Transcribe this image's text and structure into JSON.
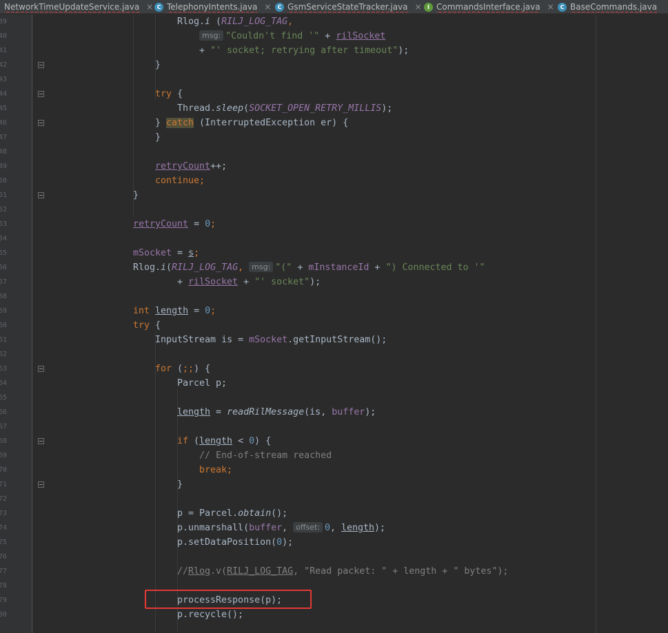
{
  "tabs": [
    {
      "label": "NetworkTimeUpdateService.java",
      "icon": "",
      "close": "×"
    },
    {
      "label": "TelephonyIntents.java",
      "icon": "C",
      "close": "×"
    },
    {
      "label": "GsmServiceStateTracker.java",
      "icon": "C",
      "close": "×"
    },
    {
      "label": "CommandsInterface.java",
      "icon": "I",
      "close": "×"
    },
    {
      "label": "BaseCommands.java",
      "icon": "C",
      "close": "×"
    }
  ],
  "line_numbers": [
    "39",
    "40",
    "41",
    "42",
    "43",
    "44",
    "45",
    "46",
    "47",
    "48",
    "49",
    "50",
    "51",
    "52",
    "53",
    "54",
    "55",
    "56",
    "57",
    "58",
    "59",
    "60",
    "61",
    "62",
    "63",
    "64",
    "65",
    "66",
    "67",
    "68",
    "69",
    "70",
    "71",
    "72",
    "73",
    "74",
    "75",
    "76",
    "77",
    "78",
    "79",
    "80"
  ],
  "code": {
    "l39": [
      "Rlog.",
      "i",
      " (",
      "RILJ_LOG_TAG",
      ","
    ],
    "l40": [
      "msg:",
      "\"Couldn't find '\"",
      " + ",
      "rilSocket"
    ],
    "l41": [
      "+ ",
      "\"' socket; retrying after timeout\"",
      ");"
    ],
    "l42": [
      "}"
    ],
    "l44": [
      "try",
      " {"
    ],
    "l45": [
      "Thread.",
      "sleep",
      "(",
      "SOCKET_OPEN_RETRY_MILLIS",
      ");"
    ],
    "l46": [
      "} ",
      "catch",
      " (InterruptedException er) {"
    ],
    "l47": [
      "}"
    ],
    "l49": [
      "retryCount",
      "++;"
    ],
    "l50": [
      "continue",
      ";"
    ],
    "l51": [
      "}"
    ],
    "l53": [
      "retryCount",
      " = ",
      "0",
      ";"
    ],
    "l55": [
      "mSocket",
      " = ",
      "s",
      ";"
    ],
    "l56": [
      "Rlog.",
      "i",
      "(",
      "RILJ_LOG_TAG",
      ", ",
      "msg:",
      "\"(\"",
      " + ",
      "mInstanceId",
      " + ",
      "\") Connected to '\""
    ],
    "l57": [
      "+ ",
      "rilSocket",
      " + ",
      "\"' socket\"",
      ");"
    ],
    "l59": [
      "int",
      " ",
      "length",
      " = ",
      "0",
      ";"
    ],
    "l60": [
      "try",
      " {"
    ],
    "l61": [
      "InputStream is = ",
      "mSocket",
      ".getInputStream();"
    ],
    "l63": [
      "for",
      " (",
      ";;",
      ") {"
    ],
    "l64": [
      "Parcel p;"
    ],
    "l66": [
      "length",
      " = ",
      "readRilMessage",
      "(is, ",
      "buffer",
      ");"
    ],
    "l68": [
      "if",
      " (",
      "length",
      " < ",
      "0",
      ") {"
    ],
    "l69": [
      "// End-of-stream reached"
    ],
    "l70": [
      "break",
      ";"
    ],
    "l71": [
      "}"
    ],
    "l73": [
      "p = Parcel.",
      "obtain",
      "();"
    ],
    "l74": [
      "p.unmarshall(",
      "buffer",
      ", ",
      "offset:",
      "0",
      ", ",
      "length",
      ");"
    ],
    "l75": [
      "p.setDataPosition(",
      "0",
      ");"
    ],
    "l77": [
      "//",
      "Rlog",
      ".v(",
      "RILJ_LOG_TAG",
      ", \"Read packet: \" + length + \" bytes\");"
    ],
    "l79": [
      "processResponse(p);"
    ],
    "l80": [
      "p.recycle();"
    ]
  },
  "colors": {
    "editor_bg": "#2b2b2b",
    "keyword": "#cc7832",
    "string": "#6a8759",
    "number": "#6897bb",
    "field": "#9876aa",
    "comment": "#808080",
    "highlight_box": "#e53935"
  }
}
